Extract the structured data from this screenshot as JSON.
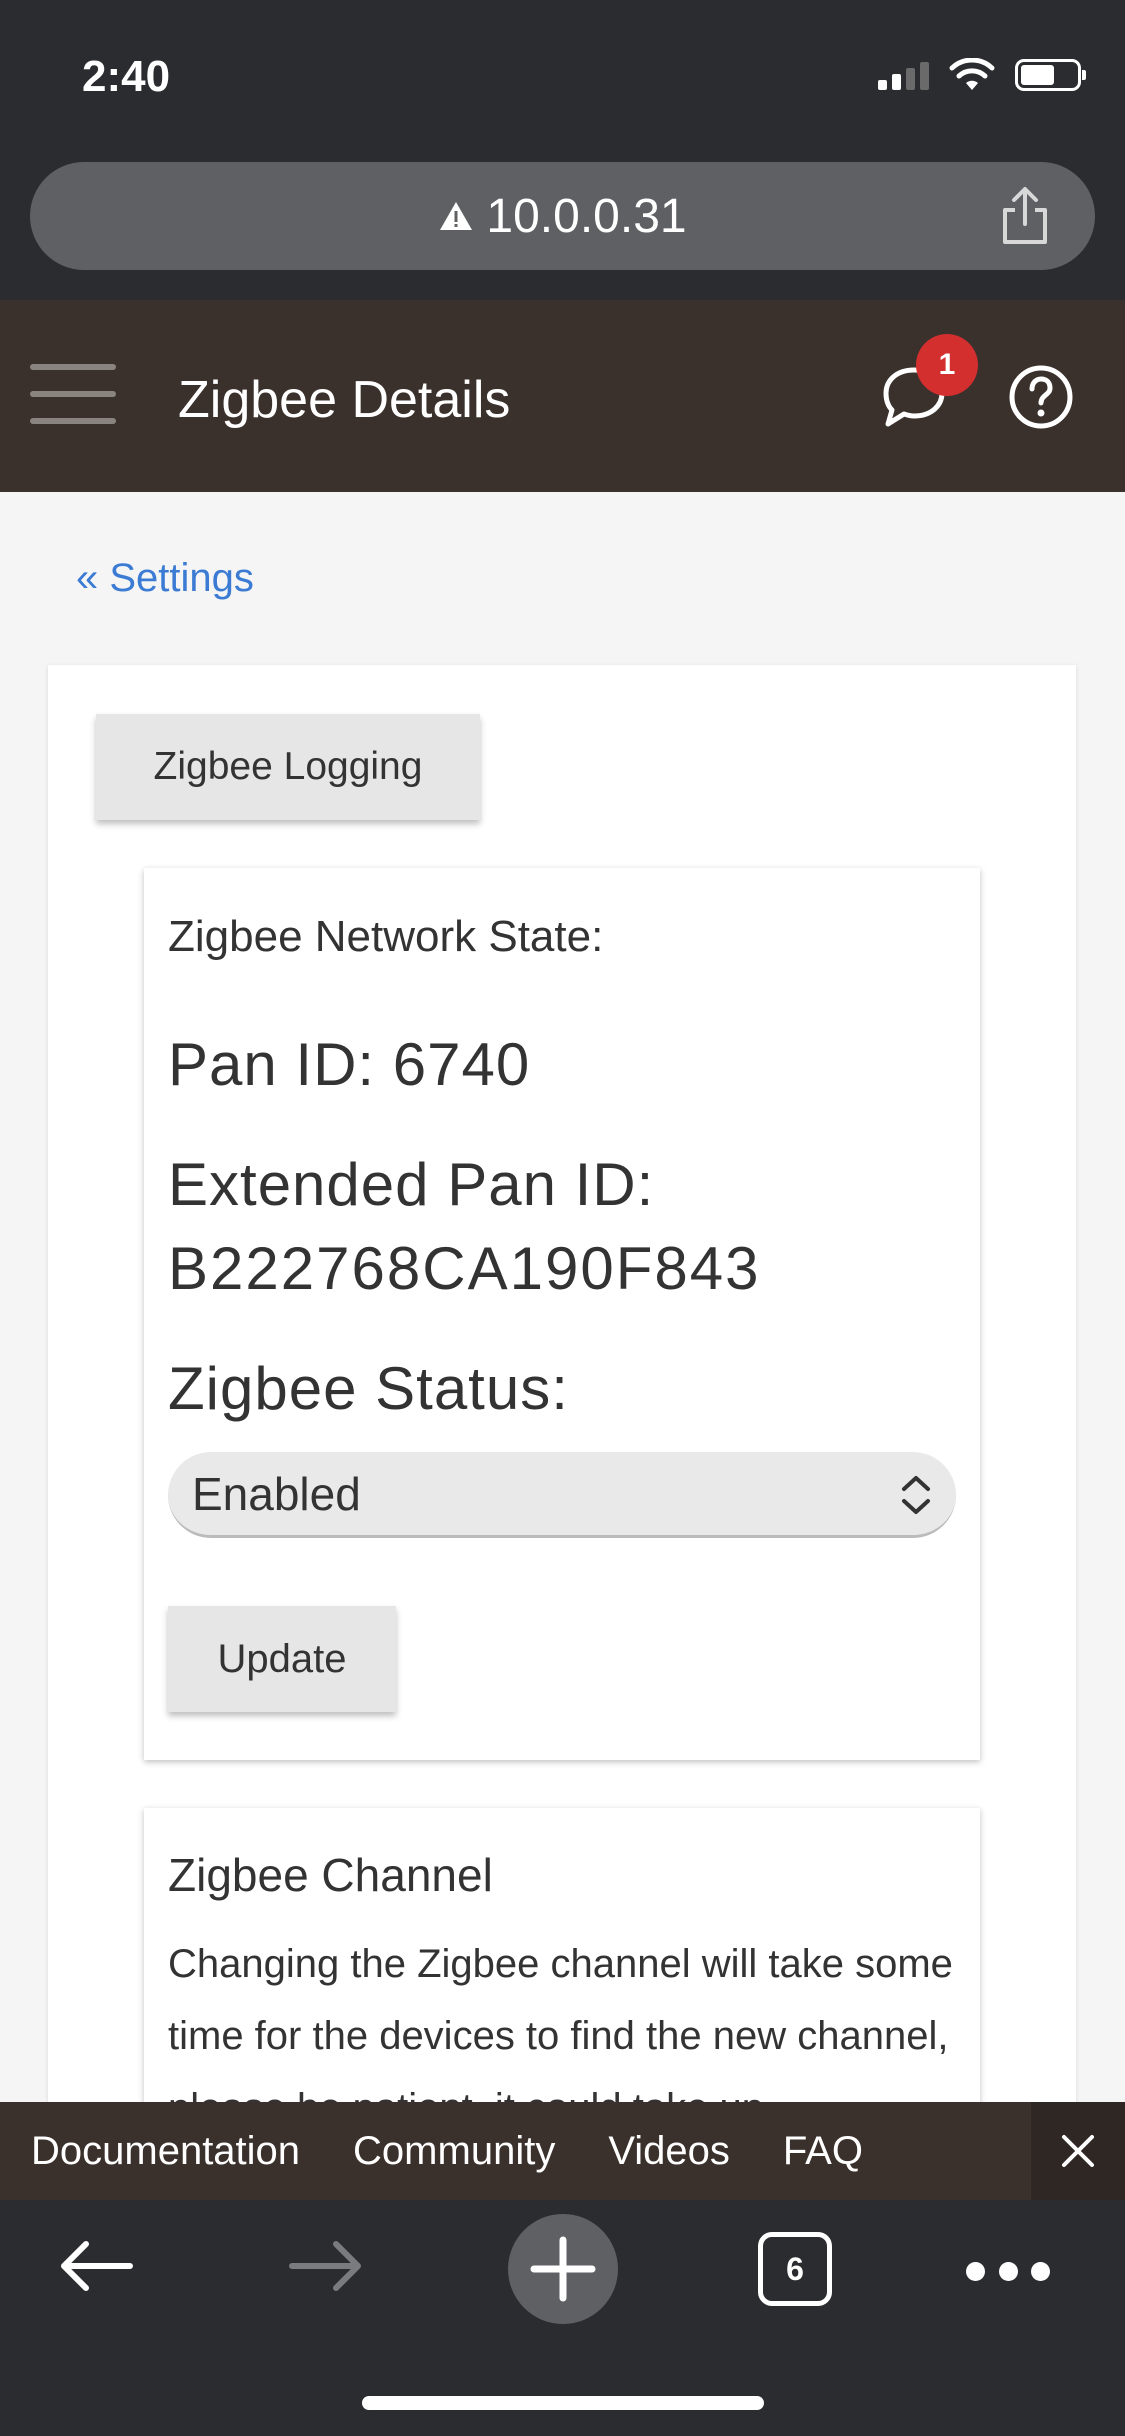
{
  "status_bar": {
    "time": "2:40"
  },
  "browser": {
    "url": "10.0.0.31",
    "tab_count": "6"
  },
  "header": {
    "title": "Zigbee Details",
    "notification_count": "1"
  },
  "breadcrumb": {
    "label": "« Settings"
  },
  "logging_button": {
    "label": "Zigbee Logging"
  },
  "network_state": {
    "heading": "Zigbee Network State:",
    "pan_id": "Pan ID: 6740",
    "extended_pan_label": "Extended Pan ID:",
    "extended_pan_value": "B222768CA190F843",
    "status_label": "Zigbee Status:",
    "status_value": "Enabled",
    "update_label": "Update"
  },
  "channel": {
    "title": "Zigbee Channel",
    "text": "Changing the Zigbee channel will take some time for the devices to find the new channel, please be patient, it could take up"
  },
  "bottom_links": [
    "Documentation",
    "Community",
    "Videos",
    "FAQ"
  ],
  "colors": {
    "header_bg": "#3a302c",
    "link_blue": "#3b7bd4",
    "badge_red": "#d32f2f",
    "chrome_bg": "#2b2c2f"
  }
}
